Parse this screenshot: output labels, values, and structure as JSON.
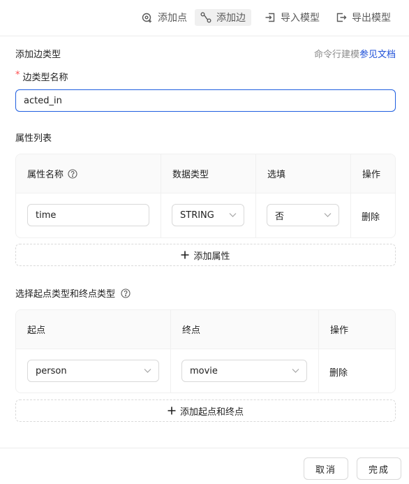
{
  "toolbar": {
    "items": [
      {
        "label": "添加点",
        "icon": "add-node-icon"
      },
      {
        "label": "添加边",
        "icon": "add-edge-icon",
        "active": true
      },
      {
        "label": "导入模型",
        "icon": "import-icon"
      },
      {
        "label": "导出模型",
        "icon": "export-icon"
      }
    ]
  },
  "form": {
    "title": "添加边类型",
    "cmd_hint": "命令行建模",
    "doc_link": "参见文档",
    "required_mark": "*",
    "name_label": "边类型名称",
    "name_value": "acted_in"
  },
  "attributes": {
    "section_title": "属性列表",
    "headers": {
      "name": "属性名称",
      "type": "数据类型",
      "option": "选填",
      "action": "操作"
    },
    "rows": [
      {
        "name": "time",
        "type": "STRING",
        "option": "否",
        "action": "删除"
      }
    ],
    "add_label": "添加属性"
  },
  "endpoints": {
    "section_title": "选择起点类型和终点类型",
    "headers": {
      "source": "起点",
      "target": "终点",
      "action": "操作"
    },
    "rows": [
      {
        "source": "person",
        "target": "movie",
        "action": "删除"
      }
    ],
    "add_label": "添加起点和终点"
  },
  "footer": {
    "cancel_label": "取消",
    "done_label": "完成"
  },
  "colors": {
    "accent": "#1f5fe0",
    "link": "#1d4fd8",
    "required": "#ff4d4f"
  }
}
